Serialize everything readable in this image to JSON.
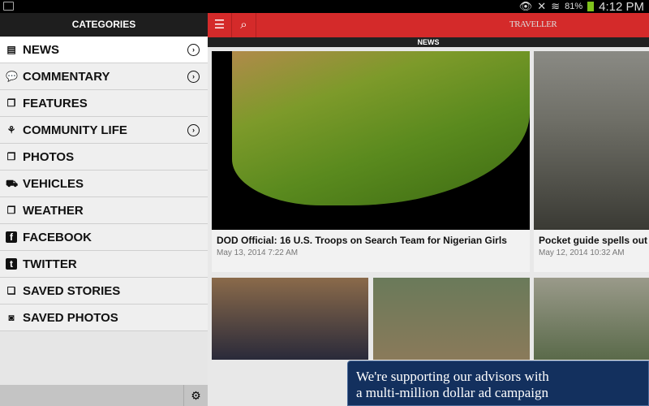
{
  "status": {
    "battery": "81%",
    "time": "4:12 PM"
  },
  "sidebar": {
    "title": "CATEGORIES",
    "items": [
      {
        "label": "NEWS",
        "icon": "newspaper-icon",
        "arrow": true
      },
      {
        "label": "COMMENTARY",
        "icon": "speech-bubble-icon",
        "arrow": true
      },
      {
        "label": "FEATURES",
        "icon": "documents-icon",
        "arrow": false
      },
      {
        "label": "COMMUNITY LIFE",
        "icon": "people-icon",
        "arrow": true
      },
      {
        "label": "PHOTOS",
        "icon": "documents-icon",
        "arrow": false
      },
      {
        "label": "VEHICLES",
        "icon": "car-icon",
        "arrow": false
      },
      {
        "label": "WEATHER",
        "icon": "documents-icon",
        "arrow": false
      },
      {
        "label": "FACEBOOK",
        "icon": "facebook-icon",
        "arrow": false
      },
      {
        "label": "TWITTER",
        "icon": "twitter-icon",
        "arrow": false
      },
      {
        "label": "SAVED STORIES",
        "icon": "saved-stories-icon",
        "arrow": false
      },
      {
        "label": "SAVED PHOTOS",
        "icon": "camera-icon",
        "arrow": false
      }
    ]
  },
  "header": {
    "logo": "TRAVELLER",
    "section": "NEWS"
  },
  "stories": [
    {
      "title": "DOD Official: 16 U.S. Troops on Search Team for Nigerian Girls",
      "date": "May 13, 2014 7:22 AM"
    },
    {
      "title": "Pocket guide spells out s",
      "date": "May 12, 2014 10:32 AM"
    }
  ],
  "ad": {
    "line1": "We're supporting our advisors with",
    "line2": "a multi-million dollar ad campaign"
  }
}
